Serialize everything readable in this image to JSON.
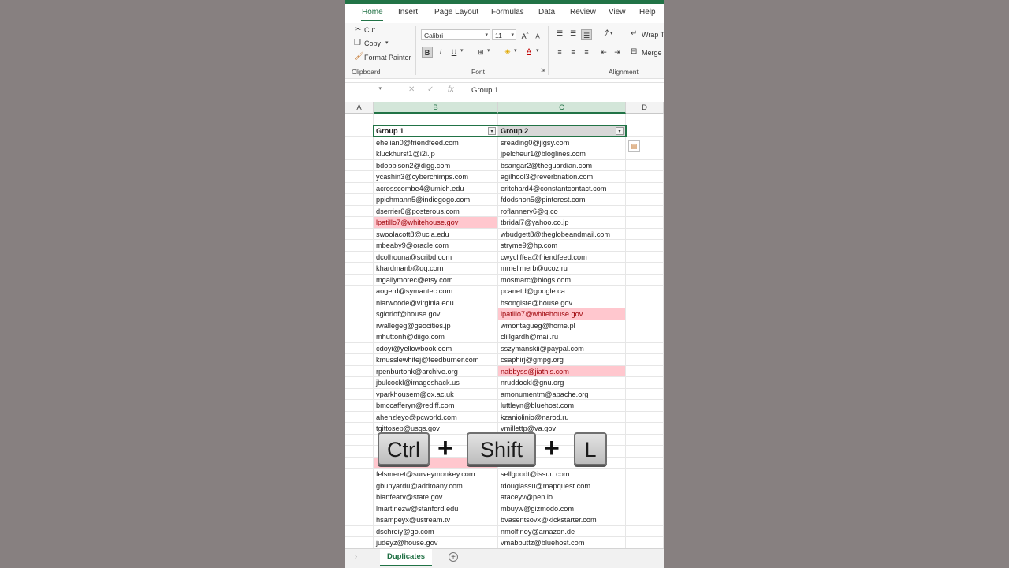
{
  "ribbon": {
    "tabs": [
      "Home",
      "Insert",
      "Page Layout",
      "Formulas",
      "Data",
      "Review",
      "View",
      "Help"
    ],
    "clipboard": {
      "cut": "Cut",
      "copy": "Copy",
      "format_painter": "Format Painter",
      "group": "Clipboard"
    },
    "font": {
      "name": "Calibri",
      "size": "11",
      "group": "Font"
    },
    "alignment": {
      "wrap": "Wrap Te",
      "merge": "Merge &",
      "group": "Alignment"
    }
  },
  "formula_bar": {
    "fx": "fx",
    "value": "Group 1"
  },
  "columns": [
    "A",
    "B",
    "C",
    "D"
  ],
  "table": {
    "headers": [
      "Group 1",
      "Group 2"
    ],
    "rows": [
      [
        "ehelian0@friendfeed.com",
        "sreading0@jigsy.com"
      ],
      [
        "kluckhurst1@i2i.jp",
        "jpelcheur1@bloglines.com"
      ],
      [
        "bdobbison2@digg.com",
        "bsangar2@theguardian.com"
      ],
      [
        "ycashin3@cyberchimps.com",
        "agilhool3@reverbnation.com"
      ],
      [
        "acrosscombe4@umich.edu",
        "eritchard4@constantcontact.com"
      ],
      [
        "ppichmann5@indiegogo.com",
        "fdodshon5@pinterest.com"
      ],
      [
        "dserrier6@posterous.com",
        "roflannery6@g.co"
      ],
      [
        "lpatillo7@whitehouse.gov",
        "tbridal7@yahoo.co.jp"
      ],
      [
        "swoolacott8@ucla.edu",
        "wbudgett8@theglobeandmail.com"
      ],
      [
        "mbeaby9@oracle.com",
        "stryme9@hp.com"
      ],
      [
        "dcolhouna@scribd.com",
        "cwycliffea@friendfeed.com"
      ],
      [
        "khardmanb@qq.com",
        "mmellmerb@ucoz.ru"
      ],
      [
        "mgallymorec@etsy.com",
        "mosmarc@blogs.com"
      ],
      [
        "aogerd@symantec.com",
        "pcanetd@google.ca"
      ],
      [
        "nlarwoode@virginia.edu",
        "hsongiste@house.gov"
      ],
      [
        "sgioriof@house.gov",
        "lpatillo7@whitehouse.gov"
      ],
      [
        "rwallegeg@geocities.jp",
        "wmontagueg@home.pl"
      ],
      [
        "mhuttonh@diigo.com",
        "clillgardh@mail.ru"
      ],
      [
        "cdoyi@yellowbook.com",
        "sszymanskii@paypal.com"
      ],
      [
        "kmusslewhitej@feedburner.com",
        "csaphirj@gmpg.org"
      ],
      [
        "rpenburtonk@archive.org",
        "nabbyss@jiathis.com"
      ],
      [
        "jbulcockl@imageshack.us",
        "nruddockl@gnu.org"
      ],
      [
        "vparkhousem@ox.ac.uk",
        "amonumentm@apache.org"
      ],
      [
        "bmccafferyn@rediff.com",
        "luttleyn@bluehost.com"
      ],
      [
        "ahenzleyo@pcworld.com",
        "kzaniolinio@narod.ru"
      ],
      [
        "tgittosep@usgs.gov",
        "vmillettp@va.gov"
      ],
      [
        "",
        ""
      ],
      [
        "",
        ""
      ],
      [
        "",
        ""
      ],
      [
        "felsmeret@surveymonkey.com",
        "sellgoodt@issuu.com"
      ],
      [
        "gbunyardu@addtoany.com",
        "tdouglassu@mapquest.com"
      ],
      [
        "blanfearv@state.gov",
        "ataceyv@pen.io"
      ],
      [
        "lmartinezw@stanford.edu",
        "mbuyw@gizmodo.com"
      ],
      [
        "hsampeyx@ustream.tv",
        "bvasentsovx@kickstarter.com"
      ],
      [
        "dschreiy@go.com",
        "nmolfinoy@amazon.de"
      ],
      [
        "judeyz@house.gov",
        "vmabbuttz@bluehost.com"
      ]
    ],
    "duplicates_b": [
      7,
      28
    ],
    "duplicates_c": [
      15,
      20
    ]
  },
  "shortcut": {
    "keys": [
      "Ctrl",
      "Shift",
      "L"
    ],
    "plus": "+"
  },
  "sheet": {
    "tab": "Duplicates",
    "add": "+"
  },
  "colors": {
    "accent": "#217346",
    "duplicate_fill": "#ffc7ce",
    "duplicate_text": "#9c0006",
    "backdrop": "#878080"
  }
}
